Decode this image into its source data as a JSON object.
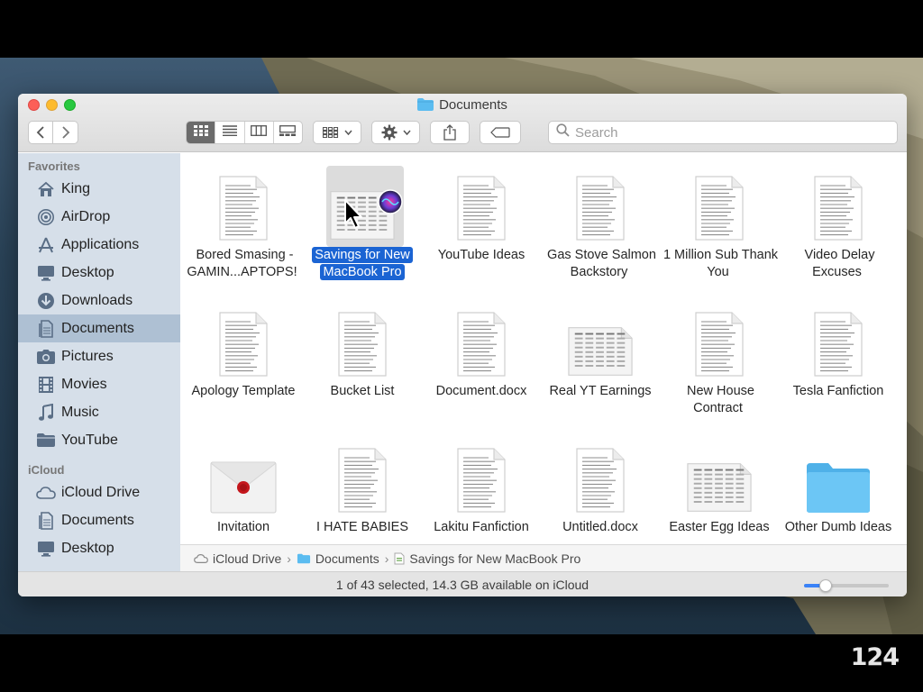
{
  "window": {
    "title": "Documents"
  },
  "toolbar": {
    "back_icon": "chevron-left-icon",
    "forward_icon": "chevron-right-icon",
    "view_modes": [
      "icon-view-icon",
      "list-view-icon",
      "column-view-icon",
      "gallery-view-icon"
    ],
    "active_view": "icon-view-icon",
    "search_placeholder": "Search"
  },
  "sidebar": {
    "favorites_heading": "Favorites",
    "favorites": [
      {
        "label": "King",
        "icon": "home-icon"
      },
      {
        "label": "AirDrop",
        "icon": "airdrop-icon"
      },
      {
        "label": "Applications",
        "icon": "applications-icon"
      },
      {
        "label": "Desktop",
        "icon": "desktop-icon"
      },
      {
        "label": "Downloads",
        "icon": "downloads-icon"
      },
      {
        "label": "Documents",
        "icon": "documents-icon",
        "selected": true
      },
      {
        "label": "Pictures",
        "icon": "camera-icon"
      },
      {
        "label": "Movies",
        "icon": "film-icon"
      },
      {
        "label": "Music",
        "icon": "music-note-icon"
      },
      {
        "label": "YouTube",
        "icon": "folder-icon"
      }
    ],
    "icloud_heading": "iCloud",
    "icloud": [
      {
        "label": "iCloud Drive",
        "icon": "cloud-icon"
      },
      {
        "label": "Documents",
        "icon": "documents-icon"
      },
      {
        "label": "Desktop",
        "icon": "desktop-icon"
      }
    ]
  },
  "files": [
    {
      "name": "Bored Smasing - GAMIN...APTOPS!",
      "kind": "document"
    },
    {
      "name": "Savings for New MacBook Pro",
      "kind": "spreadsheet",
      "selected": true
    },
    {
      "name": "YouTube Ideas",
      "kind": "document"
    },
    {
      "name": "Gas Stove Salmon Backstory",
      "kind": "document"
    },
    {
      "name": "1 Million Sub Thank You",
      "kind": "document"
    },
    {
      "name": "Video Delay Excuses",
      "kind": "document"
    },
    {
      "name": "Apology Template",
      "kind": "document"
    },
    {
      "name": "Bucket List",
      "kind": "document"
    },
    {
      "name": "Document.docx",
      "kind": "document"
    },
    {
      "name": "Real YT Earnings",
      "kind": "spreadsheet"
    },
    {
      "name": "New House Contract",
      "kind": "document"
    },
    {
      "name": "Tesla Fanfiction",
      "kind": "document"
    },
    {
      "name": "Invitation",
      "kind": "envelope"
    },
    {
      "name": "I HATE BABIES",
      "kind": "document"
    },
    {
      "name": "Lakitu Fanfiction",
      "kind": "document"
    },
    {
      "name": "Untitled.docx",
      "kind": "document"
    },
    {
      "name": "Easter Egg Ideas",
      "kind": "spreadsheet"
    },
    {
      "name": "Other Dumb Ideas",
      "kind": "folder"
    }
  ],
  "pathbar": {
    "crumbs": [
      {
        "label": "iCloud Drive",
        "icon": "cloud-icon"
      },
      {
        "label": "Documents",
        "icon": "folder-icon"
      },
      {
        "label": "Savings for New MacBook Pro",
        "icon": "spreadsheet-icon"
      }
    ]
  },
  "status": {
    "text": "1 of 43 selected, 14.3 GB available on iCloud",
    "icon_size_fraction": 0.25
  },
  "slide_number": "124",
  "colors": {
    "selection": "#1b64d3",
    "sidebar": "#d6dfe9",
    "sidebar_selected": "#aec0d3",
    "folder": "#5bbcf0"
  }
}
